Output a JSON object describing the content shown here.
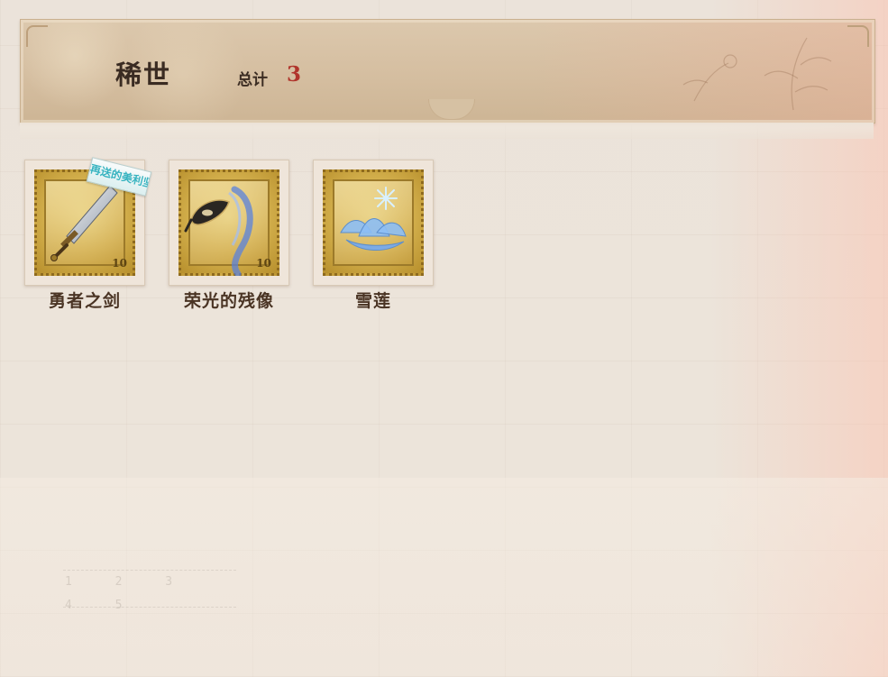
{
  "header": {
    "title": "稀世",
    "total_label": "总计",
    "total_count": "3"
  },
  "items": [
    {
      "name": "勇者之剑",
      "icon": "sword-icon",
      "tag": "再送的美利坚"
    },
    {
      "name": "荣光的残像",
      "icon": "mask-icon"
    },
    {
      "name": "雪莲",
      "icon": "snow-lotus-icon"
    }
  ],
  "colors": {
    "accent": "#b0352c",
    "text": "#3a2b22",
    "stamp_gold": "#d7b451"
  }
}
